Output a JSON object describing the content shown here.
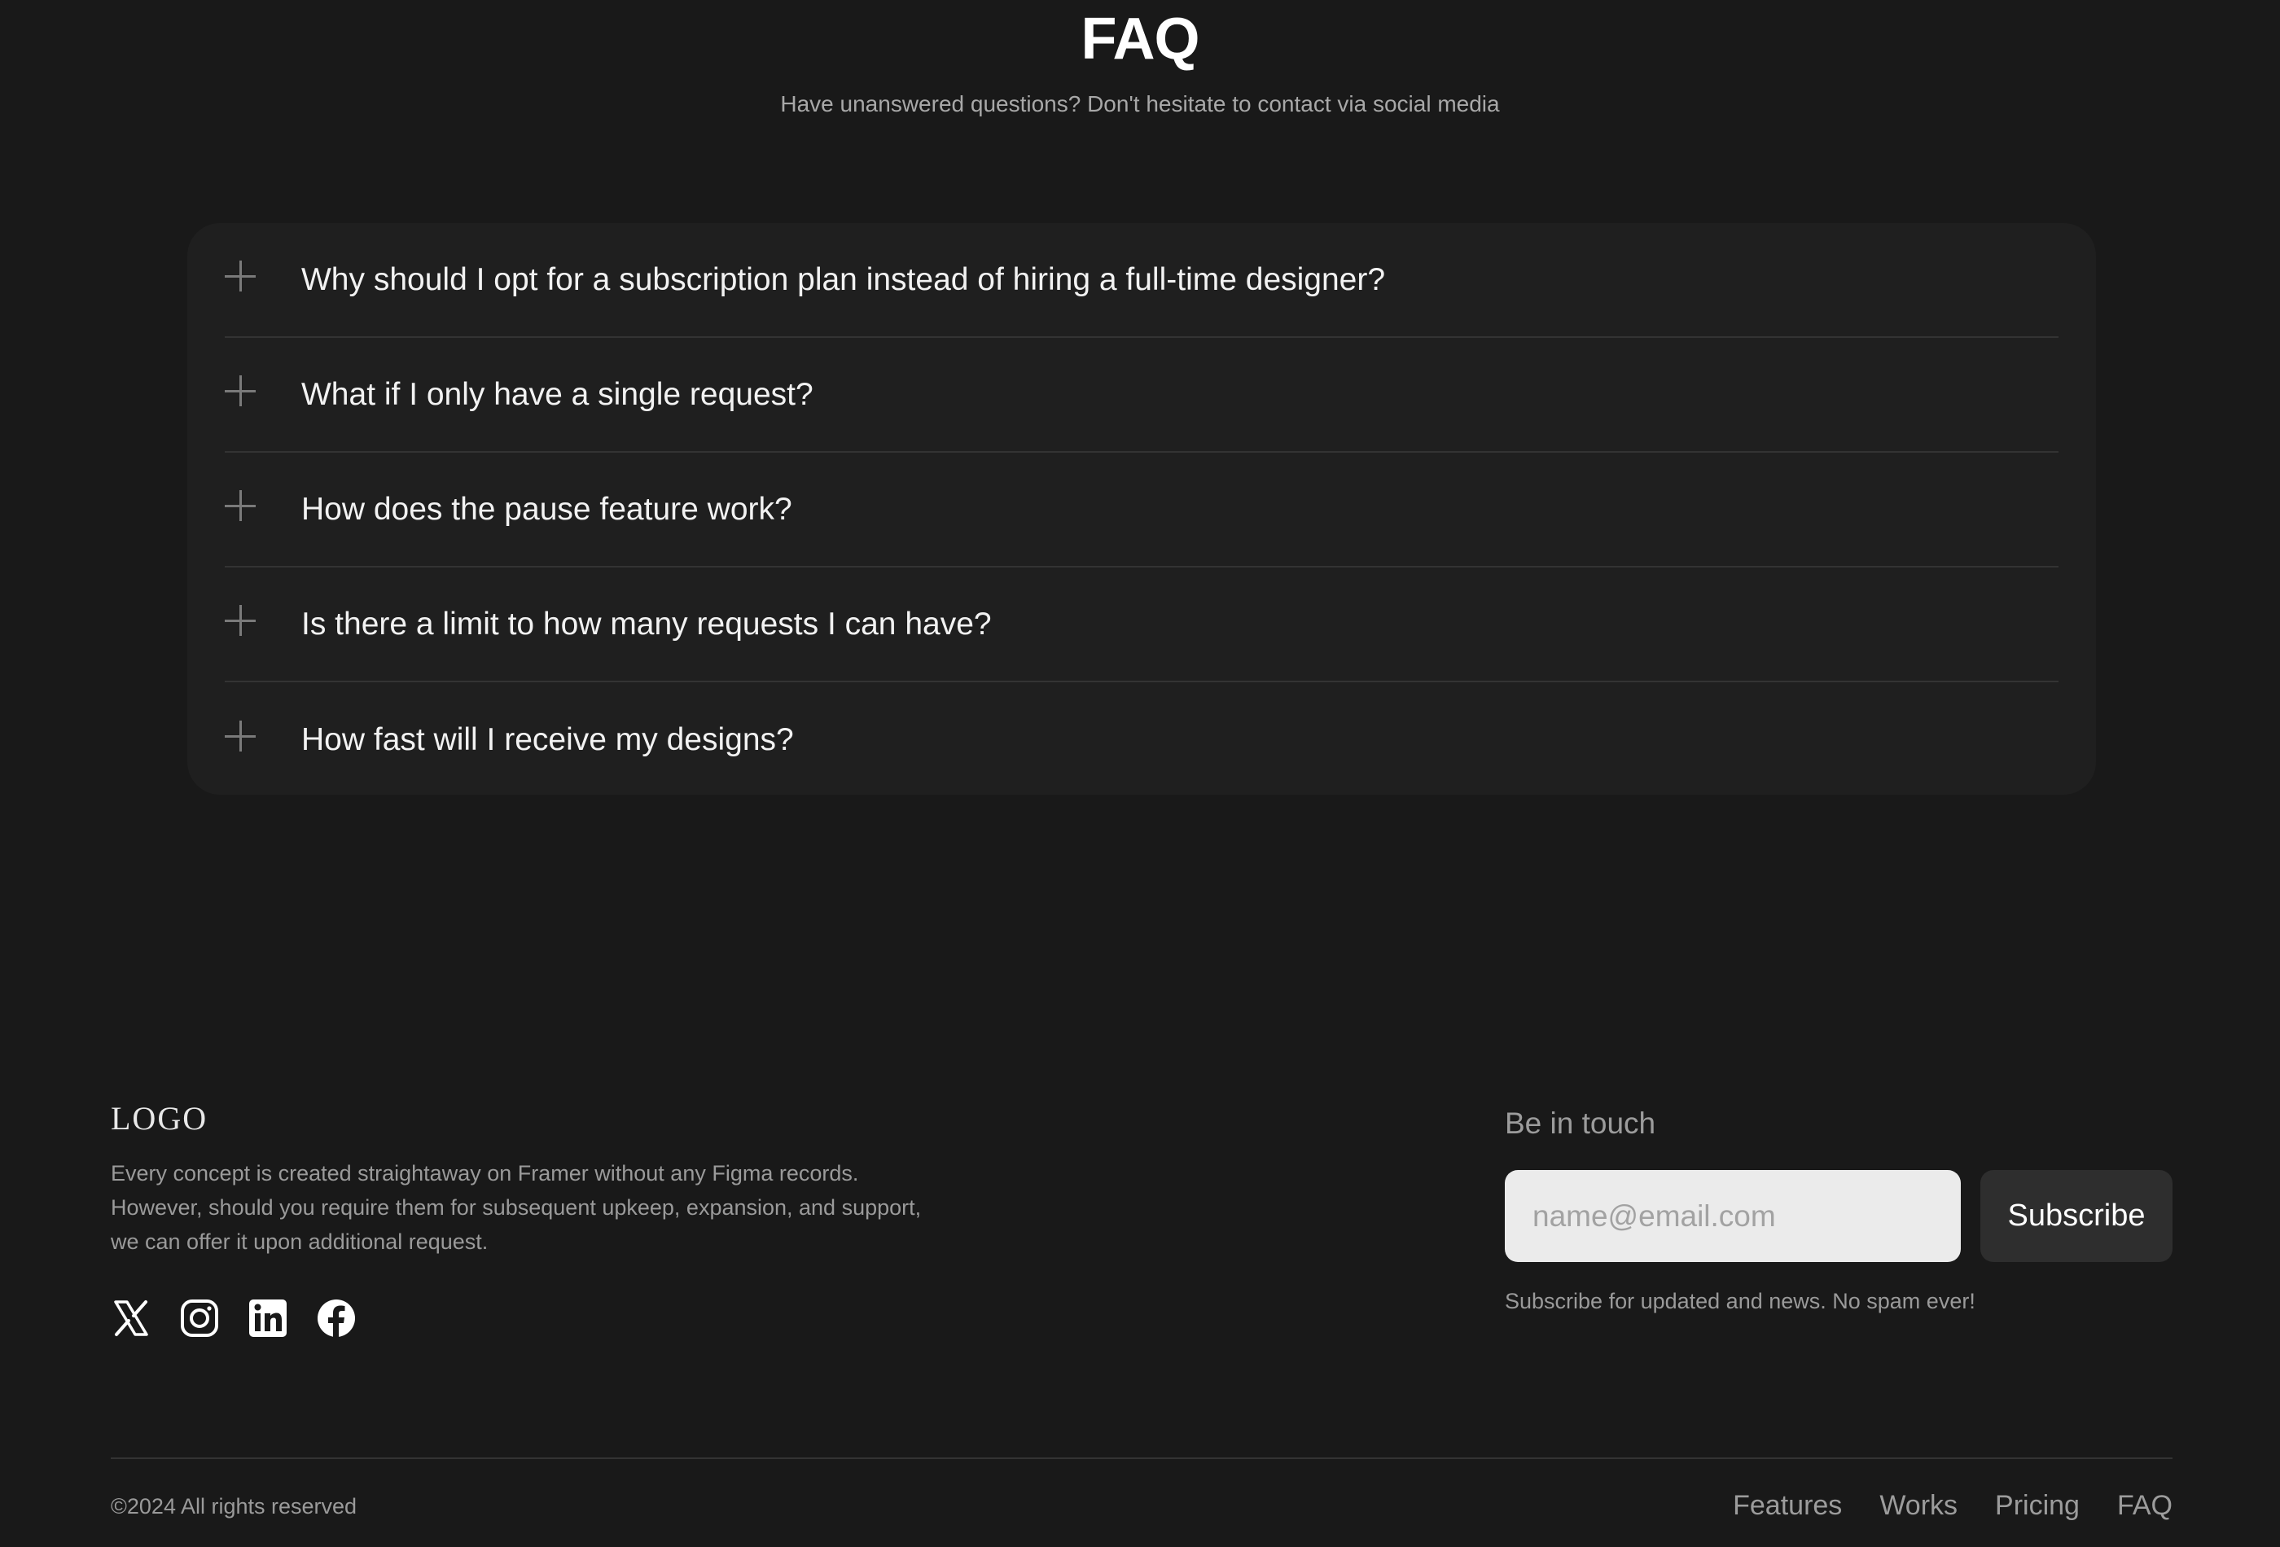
{
  "faq": {
    "title": "FAQ",
    "subtitle": "Have unanswered questions? Don't hesitate to contact via social media",
    "items": [
      {
        "question": "Why should I opt for a subscription plan instead of hiring a full-time designer?",
        "icon": "plus-icon"
      },
      {
        "question": "What if I only have a single request?",
        "icon": "plus-icon"
      },
      {
        "question": "How does the pause feature work?",
        "icon": "plus-icon"
      },
      {
        "question": "Is there a limit to how many requests I can have?",
        "icon": "plus-icon"
      },
      {
        "question": "How fast will I receive my designs?",
        "icon": "plus-icon"
      }
    ]
  },
  "footer": {
    "logo": "LOGO",
    "description": "Every concept is created straightaway on Framer without any Figma records. However, should you require them for subsequent upkeep, expansion, and support, we can offer it upon additional request.",
    "social": [
      "x-icon",
      "instagram-icon",
      "linkedin-icon",
      "facebook-icon"
    ],
    "newsletter": {
      "title": "Be in touch",
      "email_placeholder": "name@email.com",
      "email_value": "",
      "subscribe_label": "Subscribe",
      "note": "Subscribe for updated and news. No spam ever!"
    },
    "copyright": "©2024 All rights reserved",
    "nav": [
      {
        "label": "Features"
      },
      {
        "label": "Works"
      },
      {
        "label": "Pricing"
      },
      {
        "label": "FAQ"
      }
    ]
  },
  "colors": {
    "background": "#191919",
    "card": "#1f1f1f",
    "input_bg": "#ebebeb",
    "button_bg": "#2e2e2e",
    "muted_text": "#9a9a9a"
  }
}
